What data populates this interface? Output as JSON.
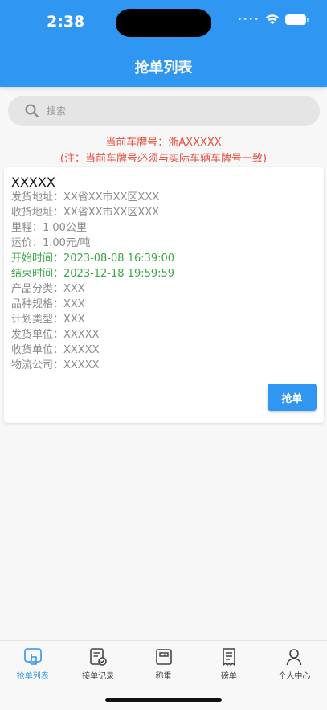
{
  "status_bar": {
    "time": "2:38"
  },
  "header": {
    "title": "抢单列表"
  },
  "search": {
    "placeholder": "搜索"
  },
  "notice": {
    "plate": "当前车牌号：浙AXXXXX",
    "hint": "(注：当前车牌号必须与实际车辆车牌号一致)"
  },
  "order": {
    "title": "XXXXX",
    "rows": [
      "发货地址：XX省XX市XX区XXX",
      "收货地址：XX省XX市XX区XXX",
      "里程：1.00公里",
      "运价：1.00元/吨",
      "开始时间：2023-08-08 16:39:00",
      "结束时间：2023-12-18 19:59:59",
      "产品分类：XXX",
      "品种规格：XXX",
      "计划类型：XXX",
      "发货单位：XXXXX",
      "收货单位：XXXXX",
      "物流公司：XXXXX"
    ],
    "button_label": "抢单"
  },
  "tabs": [
    {
      "label": "抢单列表",
      "icon": "hand-tap-icon",
      "active": true
    },
    {
      "label": "接单记录",
      "icon": "document-check-icon",
      "active": false
    },
    {
      "label": "称重",
      "icon": "scale-icon",
      "active": false
    },
    {
      "label": "磅单",
      "icon": "receipt-icon",
      "active": false
    },
    {
      "label": "个人中心",
      "icon": "person-icon",
      "active": false
    }
  ],
  "colors": {
    "primary": "#2f96f1",
    "notice_red": "#e94b3c",
    "time_green": "#3aa844"
  }
}
